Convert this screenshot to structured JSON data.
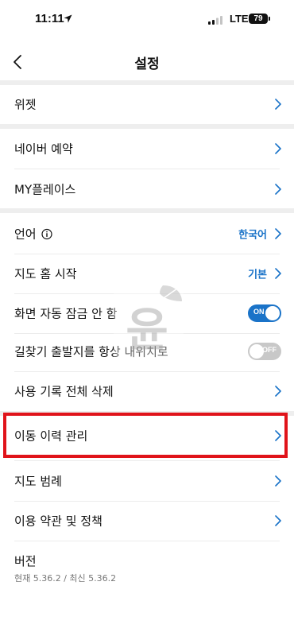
{
  "status_bar": {
    "time": "11:11",
    "network": "LTE",
    "battery": "79"
  },
  "header": {
    "title": "설정"
  },
  "rows": {
    "widget": {
      "label": "위젯"
    },
    "naver_booking": {
      "label": "네이버 예약"
    },
    "my_places": {
      "label": "MY플레이스"
    },
    "language": {
      "label": "언어",
      "value": "한국어"
    },
    "map_home_start": {
      "label": "지도 홈 시작",
      "value": "기본"
    },
    "screen_auto_lock": {
      "label": "화면 자동 잠금 안 함",
      "toggle": "ON",
      "toggle_state": true
    },
    "route_swap": {
      "label": "길찾기 출발지를 항상 내위치로",
      "toggle": "OFF",
      "toggle_state": false
    },
    "delete_history": {
      "label": "사용 기록 전체 삭제"
    },
    "movement_history": {
      "label": "이동 이력 관리"
    },
    "map_legend": {
      "label": "지도 범례"
    },
    "terms": {
      "label": "이용 약관 및 정책"
    }
  },
  "version": {
    "title": "버전",
    "info": "현재 5.36.2 / 최신 5.36.2"
  },
  "watermark": {
    "text": "윤"
  },
  "colors": {
    "accent": "#1a73c8",
    "toggle_off": "#c8c8c8",
    "highlight": "#e0131a",
    "divider": "#eeeeee"
  }
}
